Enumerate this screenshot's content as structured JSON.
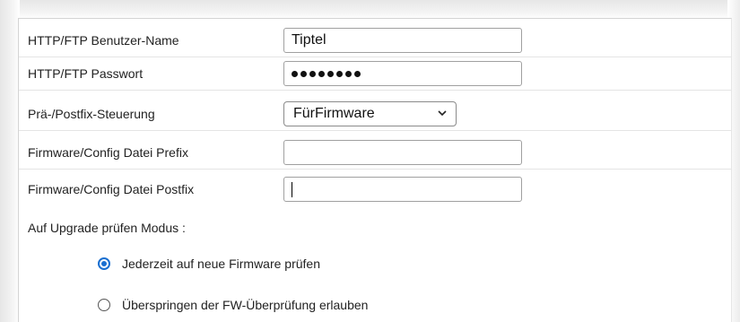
{
  "fields": {
    "username": {
      "label": "HTTP/FTP Benutzer-Name",
      "value": "Tiptel"
    },
    "password": {
      "label": "HTTP/FTP Passwort",
      "masked_length": 8
    },
    "prefix_control": {
      "label": "Prä-/Postfix-Steuerung",
      "selected": "FürFirmware"
    },
    "config_prefix": {
      "label": "Firmware/Config Datei Prefix",
      "value": ""
    },
    "config_postfix": {
      "label": "Firmware/Config Datei Postfix",
      "value": ""
    }
  },
  "upgrade_mode": {
    "label": "Auf Upgrade prüfen Modus :",
    "options": [
      {
        "label": "Jederzeit auf neue Firmware prüfen",
        "checked": true
      },
      {
        "label": "Überspringen der FW-Überprüfung erlauben",
        "checked": false
      }
    ]
  },
  "colors": {
    "accent": "#1a6fd0",
    "row_divider": "#e4e4e4",
    "input_border": "#a0a0a0"
  }
}
